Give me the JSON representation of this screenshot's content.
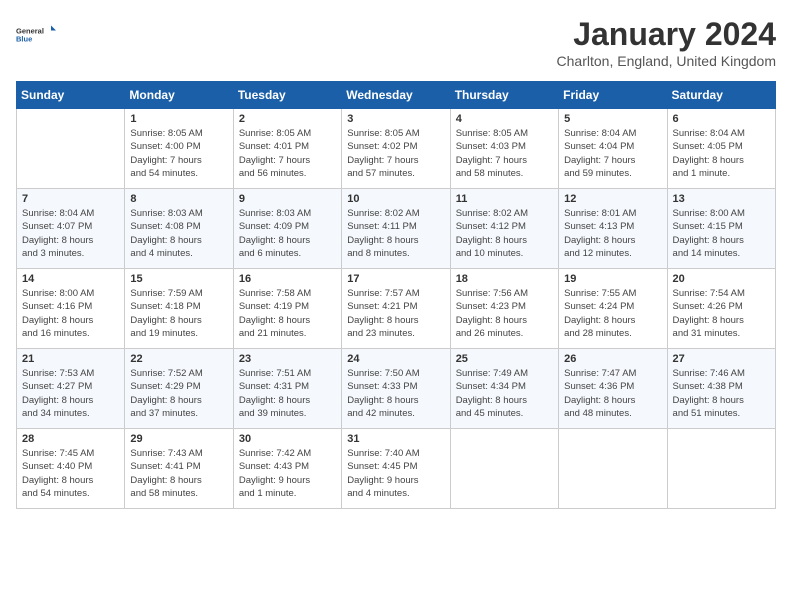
{
  "logo": {
    "line1": "General",
    "line2": "Blue"
  },
  "title": "January 2024",
  "location": "Charlton, England, United Kingdom",
  "days_of_week": [
    "Sunday",
    "Monday",
    "Tuesday",
    "Wednesday",
    "Thursday",
    "Friday",
    "Saturday"
  ],
  "weeks": [
    [
      {
        "day": "",
        "info": ""
      },
      {
        "day": "1",
        "info": "Sunrise: 8:05 AM\nSunset: 4:00 PM\nDaylight: 7 hours\nand 54 minutes."
      },
      {
        "day": "2",
        "info": "Sunrise: 8:05 AM\nSunset: 4:01 PM\nDaylight: 7 hours\nand 56 minutes."
      },
      {
        "day": "3",
        "info": "Sunrise: 8:05 AM\nSunset: 4:02 PM\nDaylight: 7 hours\nand 57 minutes."
      },
      {
        "day": "4",
        "info": "Sunrise: 8:05 AM\nSunset: 4:03 PM\nDaylight: 7 hours\nand 58 minutes."
      },
      {
        "day": "5",
        "info": "Sunrise: 8:04 AM\nSunset: 4:04 PM\nDaylight: 7 hours\nand 59 minutes."
      },
      {
        "day": "6",
        "info": "Sunrise: 8:04 AM\nSunset: 4:05 PM\nDaylight: 8 hours\nand 1 minute."
      }
    ],
    [
      {
        "day": "7",
        "info": "Sunrise: 8:04 AM\nSunset: 4:07 PM\nDaylight: 8 hours\nand 3 minutes."
      },
      {
        "day": "8",
        "info": "Sunrise: 8:03 AM\nSunset: 4:08 PM\nDaylight: 8 hours\nand 4 minutes."
      },
      {
        "day": "9",
        "info": "Sunrise: 8:03 AM\nSunset: 4:09 PM\nDaylight: 8 hours\nand 6 minutes."
      },
      {
        "day": "10",
        "info": "Sunrise: 8:02 AM\nSunset: 4:11 PM\nDaylight: 8 hours\nand 8 minutes."
      },
      {
        "day": "11",
        "info": "Sunrise: 8:02 AM\nSunset: 4:12 PM\nDaylight: 8 hours\nand 10 minutes."
      },
      {
        "day": "12",
        "info": "Sunrise: 8:01 AM\nSunset: 4:13 PM\nDaylight: 8 hours\nand 12 minutes."
      },
      {
        "day": "13",
        "info": "Sunrise: 8:00 AM\nSunset: 4:15 PM\nDaylight: 8 hours\nand 14 minutes."
      }
    ],
    [
      {
        "day": "14",
        "info": "Sunrise: 8:00 AM\nSunset: 4:16 PM\nDaylight: 8 hours\nand 16 minutes."
      },
      {
        "day": "15",
        "info": "Sunrise: 7:59 AM\nSunset: 4:18 PM\nDaylight: 8 hours\nand 19 minutes."
      },
      {
        "day": "16",
        "info": "Sunrise: 7:58 AM\nSunset: 4:19 PM\nDaylight: 8 hours\nand 21 minutes."
      },
      {
        "day": "17",
        "info": "Sunrise: 7:57 AM\nSunset: 4:21 PM\nDaylight: 8 hours\nand 23 minutes."
      },
      {
        "day": "18",
        "info": "Sunrise: 7:56 AM\nSunset: 4:23 PM\nDaylight: 8 hours\nand 26 minutes."
      },
      {
        "day": "19",
        "info": "Sunrise: 7:55 AM\nSunset: 4:24 PM\nDaylight: 8 hours\nand 28 minutes."
      },
      {
        "day": "20",
        "info": "Sunrise: 7:54 AM\nSunset: 4:26 PM\nDaylight: 8 hours\nand 31 minutes."
      }
    ],
    [
      {
        "day": "21",
        "info": "Sunrise: 7:53 AM\nSunset: 4:27 PM\nDaylight: 8 hours\nand 34 minutes."
      },
      {
        "day": "22",
        "info": "Sunrise: 7:52 AM\nSunset: 4:29 PM\nDaylight: 8 hours\nand 37 minutes."
      },
      {
        "day": "23",
        "info": "Sunrise: 7:51 AM\nSunset: 4:31 PM\nDaylight: 8 hours\nand 39 minutes."
      },
      {
        "day": "24",
        "info": "Sunrise: 7:50 AM\nSunset: 4:33 PM\nDaylight: 8 hours\nand 42 minutes."
      },
      {
        "day": "25",
        "info": "Sunrise: 7:49 AM\nSunset: 4:34 PM\nDaylight: 8 hours\nand 45 minutes."
      },
      {
        "day": "26",
        "info": "Sunrise: 7:47 AM\nSunset: 4:36 PM\nDaylight: 8 hours\nand 48 minutes."
      },
      {
        "day": "27",
        "info": "Sunrise: 7:46 AM\nSunset: 4:38 PM\nDaylight: 8 hours\nand 51 minutes."
      }
    ],
    [
      {
        "day": "28",
        "info": "Sunrise: 7:45 AM\nSunset: 4:40 PM\nDaylight: 8 hours\nand 54 minutes."
      },
      {
        "day": "29",
        "info": "Sunrise: 7:43 AM\nSunset: 4:41 PM\nDaylight: 8 hours\nand 58 minutes."
      },
      {
        "day": "30",
        "info": "Sunrise: 7:42 AM\nSunset: 4:43 PM\nDaylight: 9 hours\nand 1 minute."
      },
      {
        "day": "31",
        "info": "Sunrise: 7:40 AM\nSunset: 4:45 PM\nDaylight: 9 hours\nand 4 minutes."
      },
      {
        "day": "",
        "info": ""
      },
      {
        "day": "",
        "info": ""
      },
      {
        "day": "",
        "info": ""
      }
    ]
  ]
}
